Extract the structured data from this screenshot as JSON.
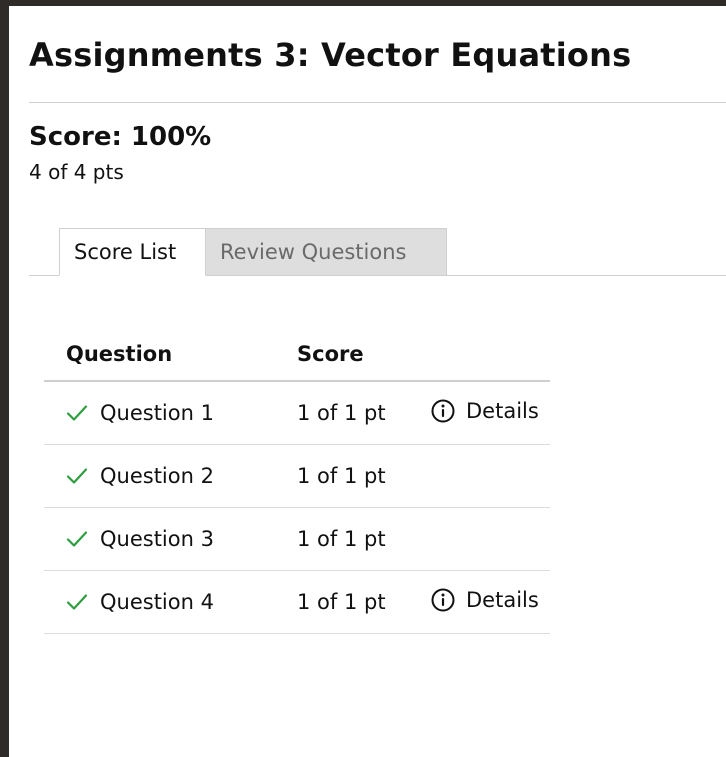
{
  "page": {
    "title": "Assignments 3: Vector Equations"
  },
  "summary": {
    "score_label": "Score: 100%",
    "points_label": "4 of 4 pts"
  },
  "tabs": [
    {
      "label": "Score List",
      "active": true
    },
    {
      "label": "Review Questions",
      "active": false
    }
  ],
  "table": {
    "headers": {
      "question": "Question",
      "score": "Score"
    },
    "rows": [
      {
        "status_icon": "check-icon",
        "question": "Question 1",
        "score": "1 of 1 pt",
        "details": "Details"
      },
      {
        "status_icon": "check-icon",
        "question": "Question 2",
        "score": "1 of 1 pt",
        "details": ""
      },
      {
        "status_icon": "check-icon",
        "question": "Question 3",
        "score": "1 of 1 pt",
        "details": ""
      },
      {
        "status_icon": "check-icon",
        "question": "Question 4",
        "score": "1 of 1 pt",
        "details": "Details"
      }
    ]
  },
  "colors": {
    "check": "#2e9e3e",
    "border": "#cfcfcf",
    "inactive_tab_bg": "#dedede",
    "inactive_tab_text": "#6a6a6a",
    "outer_background": "#2f2b29"
  },
  "icons": {
    "status": "check-icon",
    "details": "info-circle-icon"
  }
}
